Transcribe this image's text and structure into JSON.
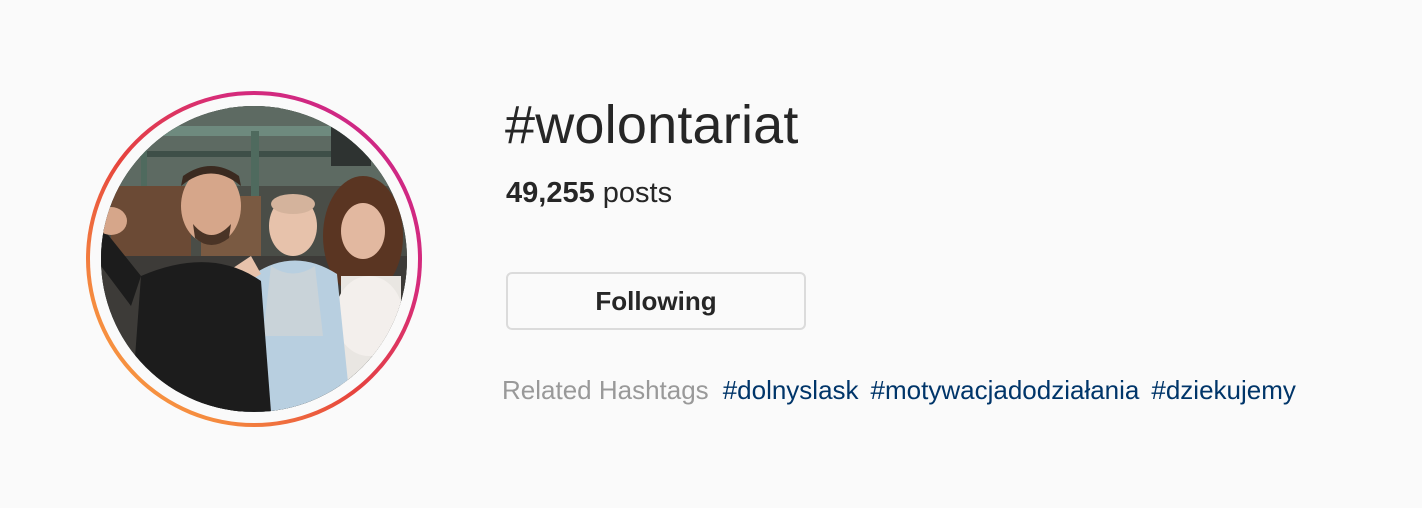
{
  "hashtag": {
    "title": "#wolontariat",
    "post_count": "49,255",
    "post_suffix": " posts"
  },
  "follow_button": {
    "label": "Following"
  },
  "related": {
    "label": "Related Hashtags",
    "tags": [
      "#dolnyslask",
      "#motywacjadodziałania",
      "#dziekujemy"
    ]
  },
  "colors": {
    "ring_start": "#f9a342",
    "ring_end": "#c7248f",
    "link": "#003569",
    "muted": "#999999",
    "text": "#262626"
  }
}
